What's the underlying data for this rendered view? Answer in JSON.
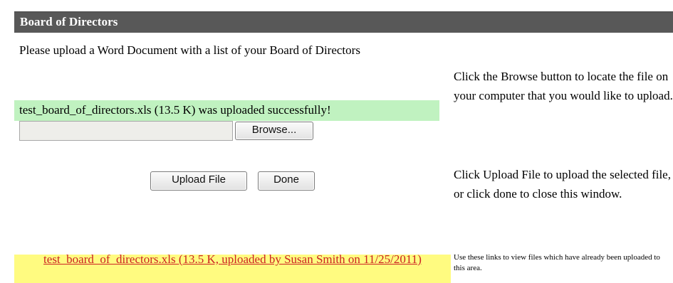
{
  "header": {
    "title": "Board of Directors"
  },
  "upload": {
    "instructions": "Please upload a Word Document with a list of your Board of Directors",
    "success_message": "test_board_of_directors.xls (13.5 K) was uploaded successfully!",
    "file_input_value": "",
    "browse_label": "Browse...",
    "upload_label": "Upload File",
    "done_label": "Done"
  },
  "help": {
    "browse_text": "Click the Browse button to locate the file on your computer that you would like to upload.",
    "upload_text": "Click Upload File to upload the selected file, or click done to close this window.",
    "files_text": "Use these links to view files which have already been uploaded to this area."
  },
  "files": [
    {
      "link_text": "test_board_of_directors.xls (13.5 K, uploaded by Susan Smith on 11/25/2011)"
    }
  ],
  "colors": {
    "header_bg": "#585858",
    "success_bg": "#c0f2c0",
    "files_bg": "#fffb80",
    "link": "#cc2222"
  }
}
